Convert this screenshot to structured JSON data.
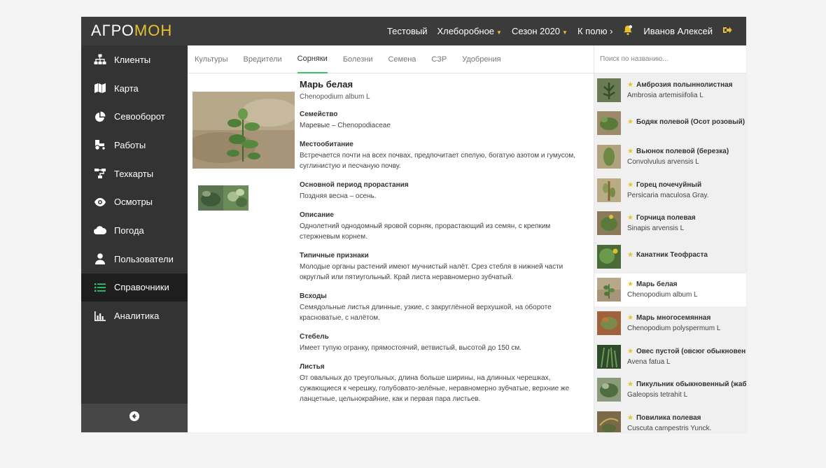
{
  "app": {
    "logo_part1": "АГРО",
    "logo_part2": "МОН"
  },
  "topbar": {
    "items": [
      {
        "label": "Тестовый",
        "dropdown": false
      },
      {
        "label": "Хлеборобное",
        "dropdown": true
      },
      {
        "label": "Сезон 2020",
        "dropdown": true
      },
      {
        "label": "К полю ›",
        "dropdown": false
      }
    ],
    "user": "Иванов Алексей"
  },
  "sidebar": {
    "items": [
      {
        "label": "Клиенты",
        "icon": "sitemap-icon",
        "active": false
      },
      {
        "label": "Карта",
        "icon": "map-icon",
        "active": false
      },
      {
        "label": "Севооборот",
        "icon": "pie-chart-icon",
        "active": false
      },
      {
        "label": "Работы",
        "icon": "tractor-icon",
        "active": false
      },
      {
        "label": "Техкарты",
        "icon": "flowchart-icon",
        "active": false
      },
      {
        "label": "Осмотры",
        "icon": "eye-icon",
        "active": false
      },
      {
        "label": "Погода",
        "icon": "cloud-icon",
        "active": false
      },
      {
        "label": "Пользователи",
        "icon": "user-icon",
        "active": false
      },
      {
        "label": "Справочники",
        "icon": "list-icon",
        "active": true
      },
      {
        "label": "Аналитика",
        "icon": "bar-chart-icon",
        "active": false
      }
    ]
  },
  "tabs": [
    {
      "label": "Культуры",
      "active": false
    },
    {
      "label": "Вредители",
      "active": false
    },
    {
      "label": "Сорняки",
      "active": true
    },
    {
      "label": "Болезни",
      "active": false
    },
    {
      "label": "Семена",
      "active": false
    },
    {
      "label": "СЗР",
      "active": false
    },
    {
      "label": "Удобрения",
      "active": false
    }
  ],
  "detail": {
    "title": "Марь белая",
    "latin": "Chenopodium album L",
    "sections": [
      {
        "heading": "Семейство",
        "text": "Маревые – Chenopodiaceae"
      },
      {
        "heading": "Местообитание",
        "text": "Встречается почти на всех почвах, предпочитает спелую, богатую азотом и гумусом, суглинистую и песчаную почву."
      },
      {
        "heading": "Основной период прорастания",
        "text": "Поздняя весна – осень."
      },
      {
        "heading": "Описание",
        "text": "Однолетний однодомный яровой сорняк, прорастающий из семян, с крепким стержневым корнем."
      },
      {
        "heading": "Типичные признаки",
        "text": "Молодые органы растений имеют мучнистый налёт. Срез стебля в нижней части округлый или пятиугольный. Край листа неравномерно зубчатый."
      },
      {
        "heading": "Всходы",
        "text": "Семядольные листья длинные, узкие, с закруглённой верхушкой, на обороте красноватые, с налётом."
      },
      {
        "heading": "Стебель",
        "text": "Имеет тупую огранку, прямостоячий, ветвистый, высотой до 150 см."
      },
      {
        "heading": "Листья",
        "text": "От овальных до треугольных, длина больше ширины, на длинных черешках, сужающиеся к черешку, голубовато-зелёные, неравномерно зубчатые, верхние же ланцетные, цельнокрайние, как и первая пара листьев."
      }
    ]
  },
  "search": {
    "placeholder": "Поиск по названию...",
    "value": ""
  },
  "weeds": [
    {
      "name": "Амброзия полыннолистная",
      "latin": "Ambrosia artemisiifolia L",
      "active": false
    },
    {
      "name": "Бодяк полевой (Осот розовый)",
      "latin": "",
      "active": false
    },
    {
      "name": "Вьюнок полевой (березка)",
      "latin": "Convolvulus arvensis L",
      "active": false
    },
    {
      "name": "Горец почечуйный",
      "latin": "Persicaria maculosa Gray.",
      "active": false
    },
    {
      "name": "Горчица полевая",
      "latin": "Sinapis arvensis L",
      "active": false
    },
    {
      "name": "Канатник Теофраста",
      "latin": "",
      "active": false
    },
    {
      "name": "Марь белая",
      "latin": "Chenopodium album L",
      "active": true
    },
    {
      "name": "Марь многосемянная",
      "latin": "Chenopodium polyspermum L",
      "active": false
    },
    {
      "name": "Овес пустой (овсюг обыкновенный)",
      "latin": "Avena fatua L",
      "active": false
    },
    {
      "name": "Пикульник обыкновенный (жабрей)",
      "latin": "Galeopsis tetrahit L",
      "active": false
    },
    {
      "name": "Повилика полевая",
      "latin": "Cuscuta campestris Yunck.",
      "active": false
    }
  ],
  "colors": {
    "accent": "#39c36c",
    "brand": "#e8c030",
    "topbar": "#3b3b3b",
    "sidebar": "#333333"
  }
}
